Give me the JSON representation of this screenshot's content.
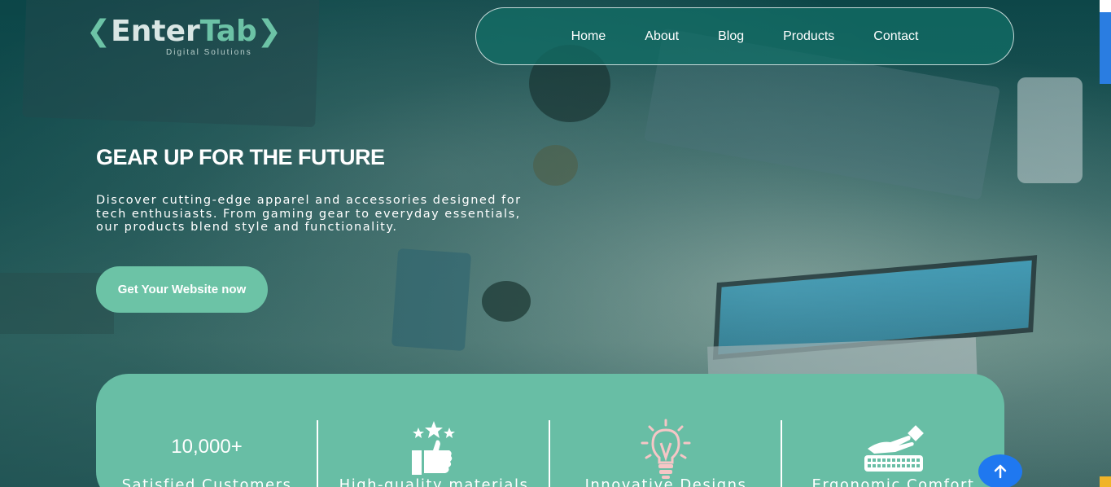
{
  "logo": {
    "brand_left": "Enter",
    "brand_right": "Tab",
    "tagline": "Digital Solutions",
    "accent_color": "#6cc3a6"
  },
  "nav": {
    "items": [
      {
        "label": "Home"
      },
      {
        "label": "About"
      },
      {
        "label": "Blog"
      },
      {
        "label": "Products"
      },
      {
        "label": "Contact"
      }
    ]
  },
  "hero": {
    "title": "GEAR UP FOR THE FUTURE",
    "description": "Discover cutting-edge apparel and accessories designed for tech enthusiasts. From gaming gear to everyday essentials, our products blend style and functionality.",
    "cta_label": "Get Your Website now"
  },
  "stats": {
    "items": [
      {
        "number": "10,000+",
        "label": "Satisfied Customers",
        "icon": "none"
      },
      {
        "label": "High-quality materials",
        "icon": "thumbs-up-stars-icon"
      },
      {
        "label": "Innovative Designs",
        "icon": "lightbulb-icon"
      },
      {
        "label": "Ergonomic Comfort",
        "icon": "hand-keyboard-icon"
      }
    ],
    "panel_color": "#68bea5"
  },
  "back_to_top": {
    "icon": "arrow-up-icon",
    "color": "#1f78f0"
  }
}
